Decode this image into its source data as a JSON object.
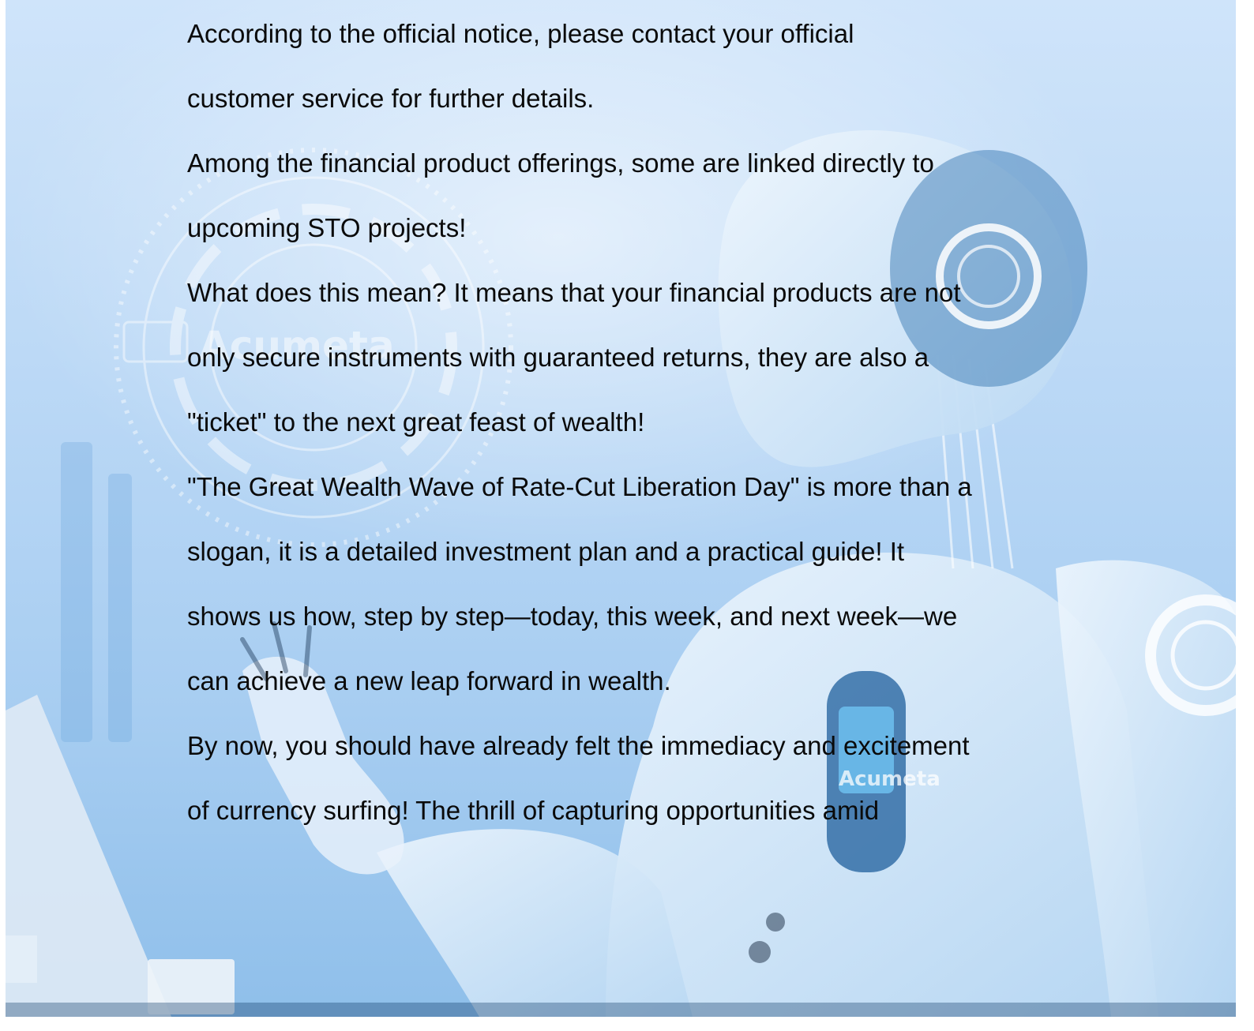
{
  "background": {
    "logo_text": "Acumeta",
    "colors": {
      "top": "#cfe4fa",
      "bottom": "#8fbfea",
      "robot_body": "#e6f1fb",
      "accent": "#5aa8e8"
    }
  },
  "paragraphs": [
    {
      "lines": [
        "According to the official notice, please contact your official",
        "customer service for further details."
      ]
    },
    {
      "lines": [
        "Among the financial product offerings, some are linked directly to",
        "upcoming STO projects!"
      ]
    },
    {
      "lines": [
        "What does this mean? It means that your financial products are not",
        "only secure instruments with guaranteed returns, they are also a",
        "\"ticket\" to the next great feast of wealth!"
      ]
    },
    {
      "lines": [
        "\"The Great Wealth Wave of Rate-Cut Liberation Day\" is more than a",
        "slogan, it is a detailed investment plan and a practical guide! It",
        "shows us how, step by step—today, this week, and next week—we",
        "can achieve a new leap forward in wealth."
      ]
    },
    {
      "lines": [
        "By now, you should have already felt the immediacy and excitement",
        "of currency surfing! The thrill of capturing opportunities amid"
      ]
    }
  ]
}
